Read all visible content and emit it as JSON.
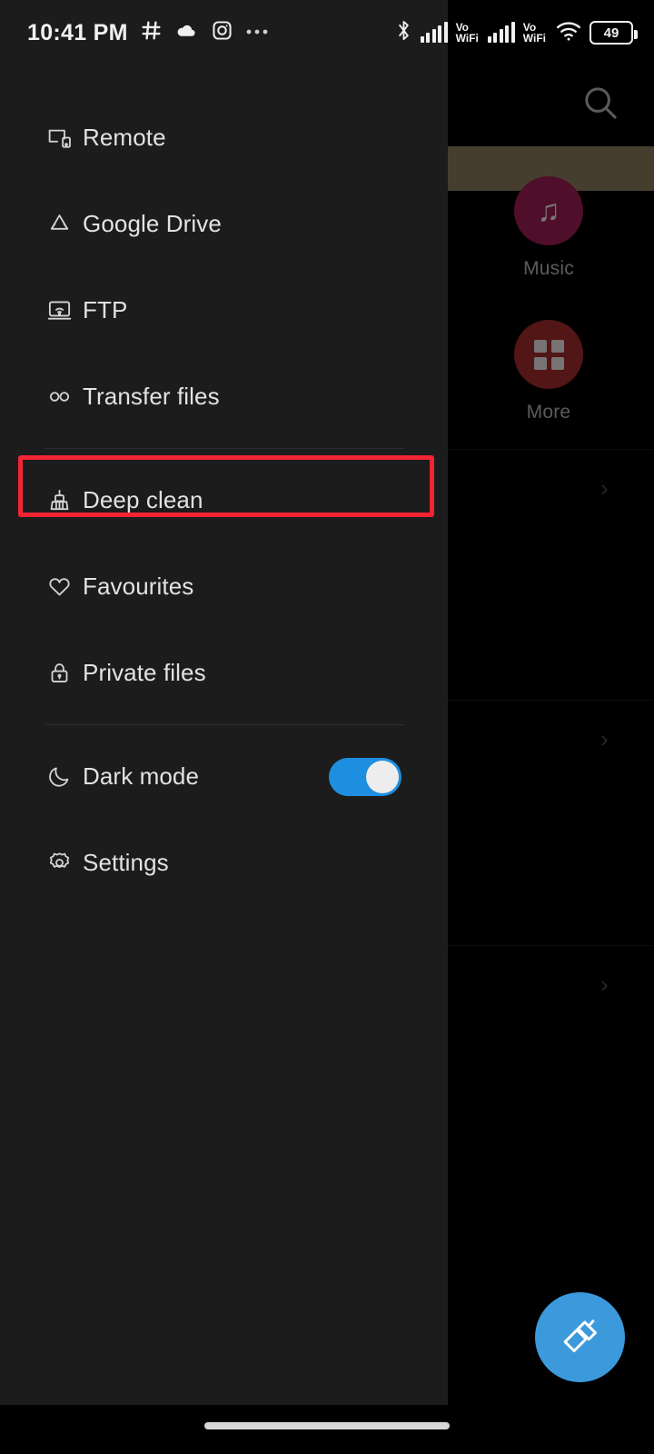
{
  "status_bar": {
    "time": "10:41 PM",
    "left_icons": [
      "slack-icon",
      "onedrive-icon",
      "instagram-icon",
      "overflow-dots-icon"
    ],
    "right_icons": [
      "bluetooth-icon",
      "signal-bars-sim1-icon",
      "volte-wifi-sim1-label",
      "signal-bars-sim2-icon",
      "volte-wifi-sim2-label",
      "wifi-icon",
      "battery-icon"
    ],
    "vowifi_top": "Vo",
    "vowifi_bottom": "WiFi",
    "battery_level": "49"
  },
  "drawer": {
    "items": [
      {
        "label": "Remote",
        "icon": "remote-cast-icon",
        "type": "nav"
      },
      {
        "label": "Google Drive",
        "icon": "google-drive-icon",
        "type": "nav"
      },
      {
        "label": "FTP",
        "icon": "ftp-screen-icon",
        "type": "nav"
      },
      {
        "label": "Transfer files",
        "icon": "infinity-icon",
        "type": "nav"
      },
      {
        "label": "Deep clean",
        "icon": "broom-icon",
        "type": "nav"
      },
      {
        "label": "Favourites",
        "icon": "heart-icon",
        "type": "nav"
      },
      {
        "label": "Private files",
        "icon": "lock-icon",
        "type": "nav"
      },
      {
        "label": "Dark mode",
        "icon": "moon-icon",
        "type": "toggle",
        "toggle_on": true
      },
      {
        "label": "Settings",
        "icon": "gear-icon",
        "type": "nav"
      }
    ]
  },
  "highlight": {
    "target_label": "Deep clean",
    "color": "#f42434"
  },
  "background": {
    "search_icon": "search-icon",
    "categories": [
      {
        "label": "Music",
        "icon": "music-note-icon",
        "color": "#7a1640"
      },
      {
        "label": "More",
        "icon": "grid-apps-icon",
        "color": "#7e2222"
      }
    ],
    "chevrons": [
      "chevron-right-icon",
      "chevron-right-icon",
      "chevron-right-icon"
    ],
    "accent_bar_color": "#6b6049"
  },
  "fab": {
    "icon": "broom-sweep-icon",
    "color": "#3c9adc"
  },
  "gesture_bar": {
    "present": true
  }
}
